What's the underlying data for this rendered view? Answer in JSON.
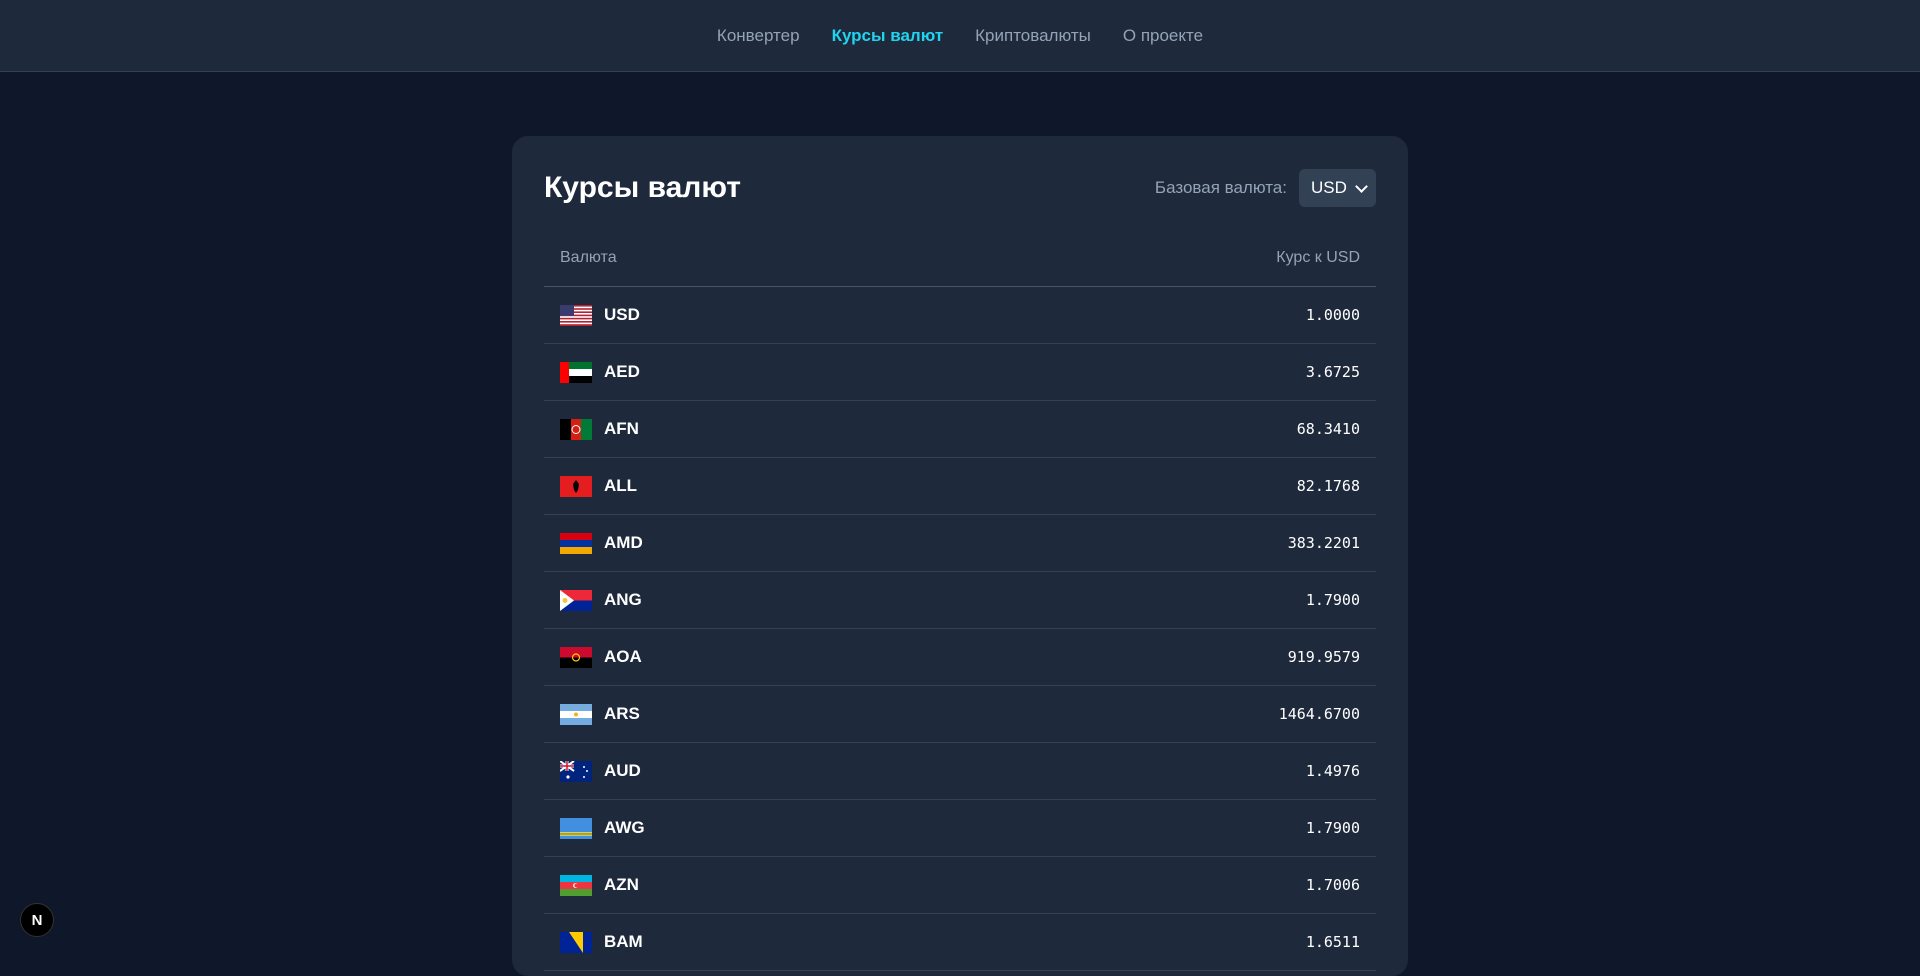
{
  "nav": {
    "items": [
      {
        "label": "Конвертер",
        "active": false
      },
      {
        "label": "Курсы валют",
        "active": true
      },
      {
        "label": "Криптовалюты",
        "active": false
      },
      {
        "label": "О проекте",
        "active": false
      }
    ]
  },
  "card": {
    "title": "Курсы валют",
    "base_label": "Базовая валюта:",
    "base_value": "USD"
  },
  "table": {
    "headers": {
      "currency": "Валюта",
      "rate": "Курс к USD"
    },
    "rows": [
      {
        "code": "USD",
        "rate": "1.0000",
        "flag": "us-flag-icon"
      },
      {
        "code": "AED",
        "rate": "3.6725",
        "flag": "ae-flag-icon"
      },
      {
        "code": "AFN",
        "rate": "68.3410",
        "flag": "af-flag-icon"
      },
      {
        "code": "ALL",
        "rate": "82.1768",
        "flag": "al-flag-icon"
      },
      {
        "code": "AMD",
        "rate": "383.2201",
        "flag": "am-flag-icon"
      },
      {
        "code": "ANG",
        "rate": "1.7900",
        "flag": "sx-flag-icon"
      },
      {
        "code": "AOA",
        "rate": "919.9579",
        "flag": "ao-flag-icon"
      },
      {
        "code": "ARS",
        "rate": "1464.6700",
        "flag": "ar-flag-icon"
      },
      {
        "code": "AUD",
        "rate": "1.4976",
        "flag": "au-flag-icon"
      },
      {
        "code": "AWG",
        "rate": "1.7900",
        "flag": "aw-flag-icon"
      },
      {
        "code": "AZN",
        "rate": "1.7006",
        "flag": "az-flag-icon"
      },
      {
        "code": "BAM",
        "rate": "1.6511",
        "flag": "ba-flag-icon"
      }
    ]
  },
  "badge": {
    "letter": "N",
    "icon": "nextjs-icon"
  },
  "colors": {
    "accent": "#22d3ee",
    "background": "#0f172a",
    "card": "#1e293b"
  }
}
